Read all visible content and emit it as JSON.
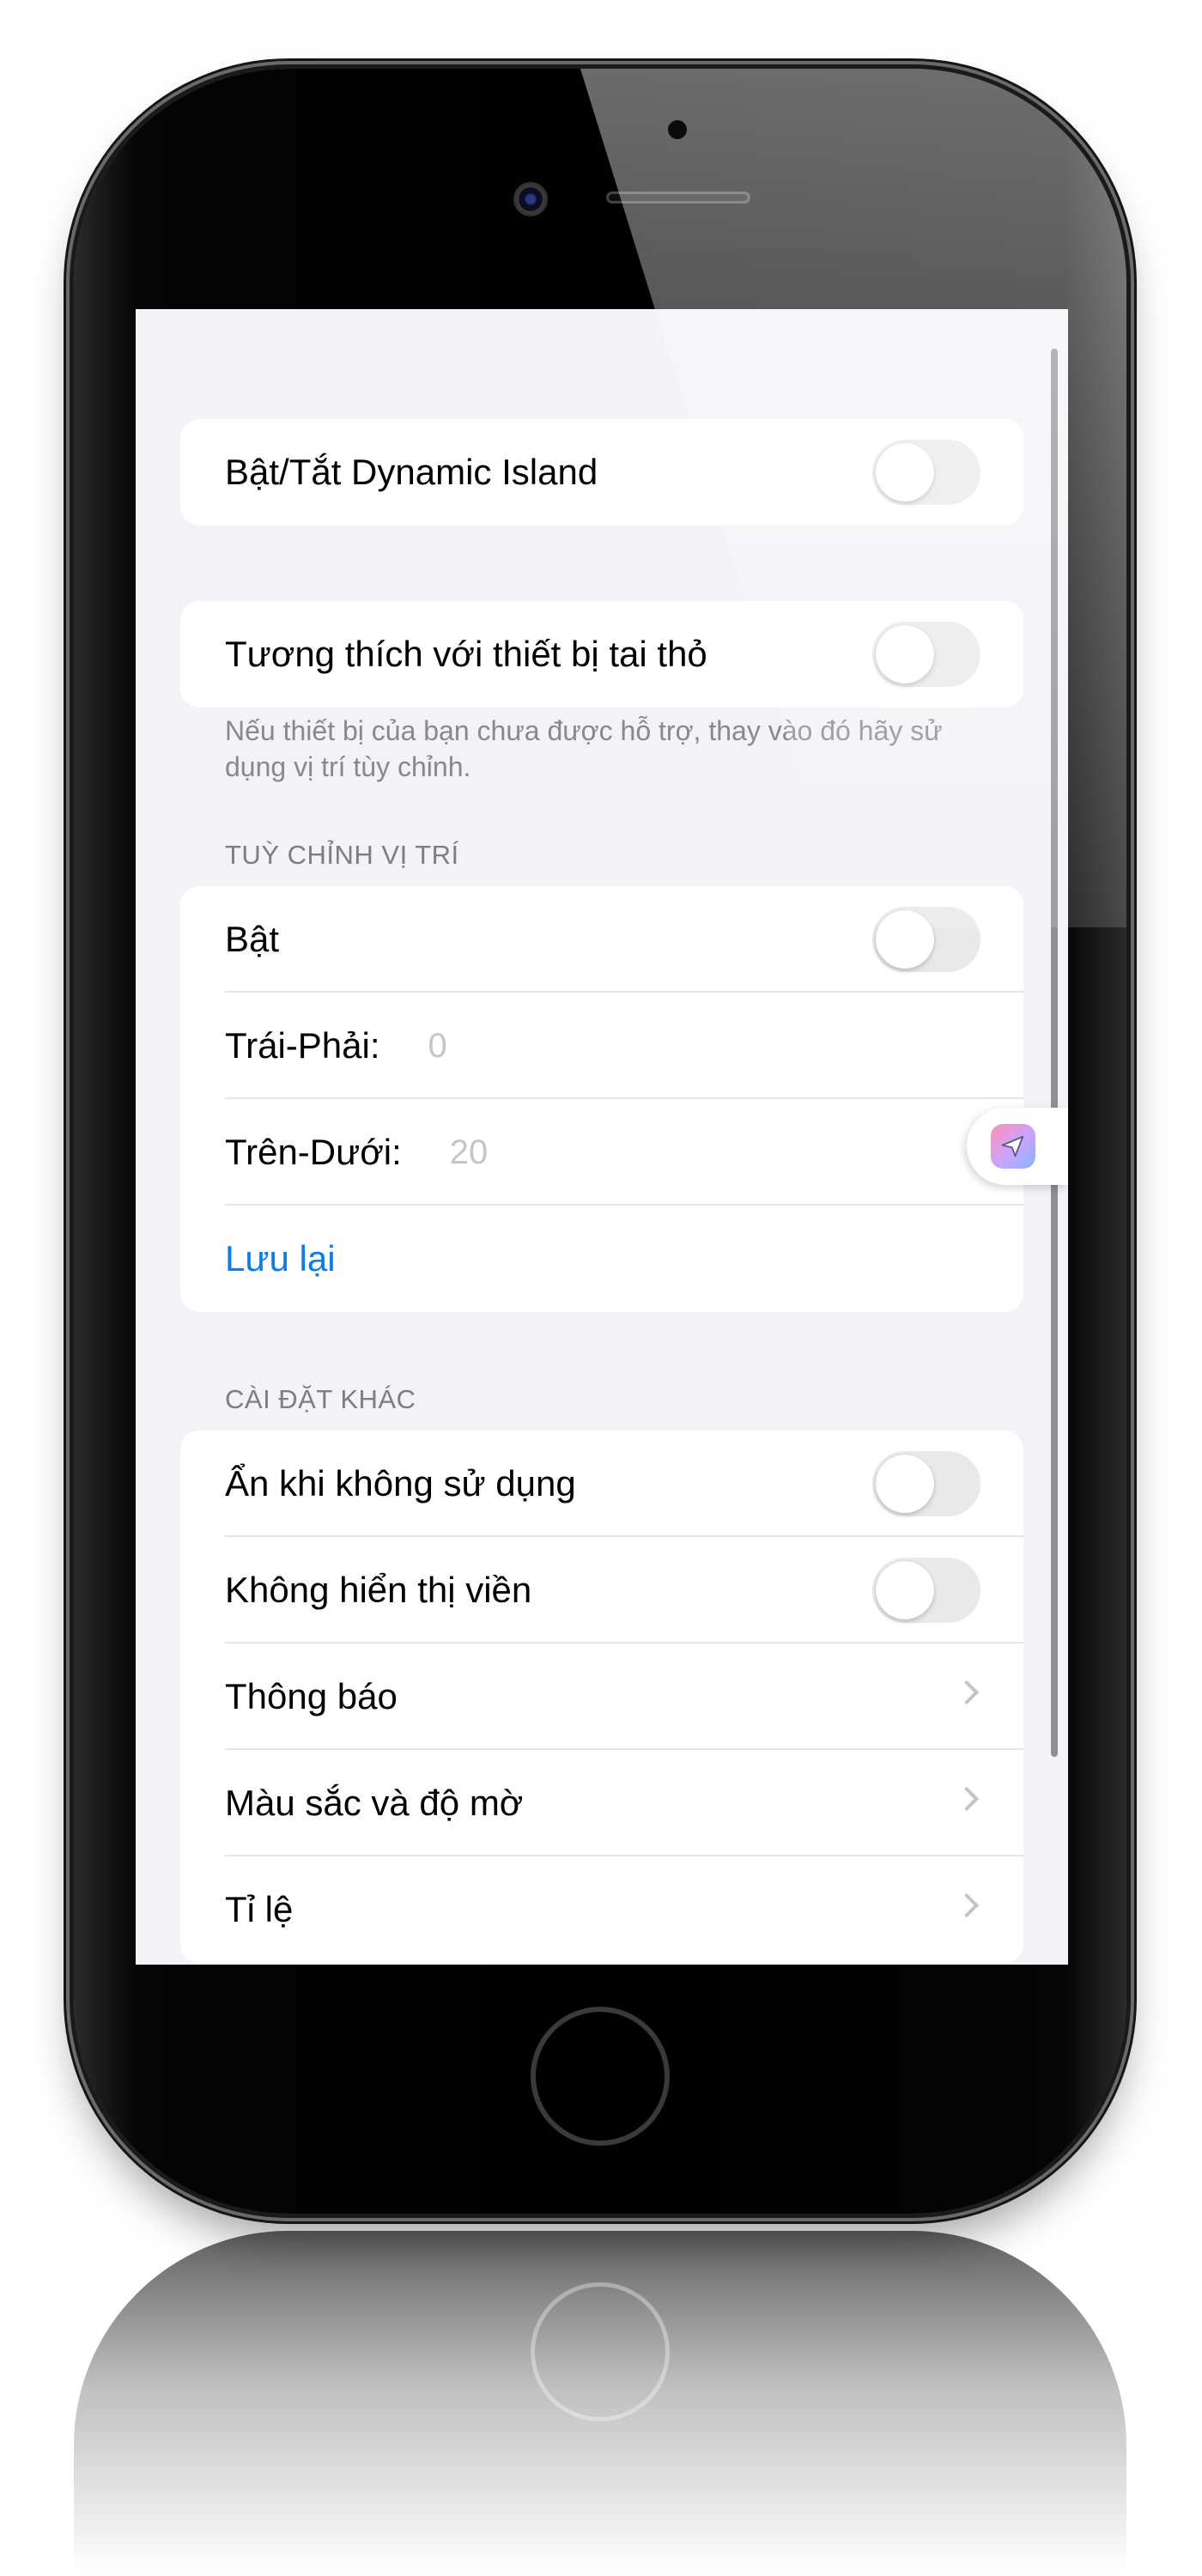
{
  "colors": {
    "background": "#f2f2f7",
    "card": "#ffffff",
    "accent": "#0a7cf2",
    "toggle_off": "#e9e9ea",
    "section_header": "#7d7d82"
  },
  "settings": {
    "dynamic_island": {
      "label": "Bật/Tắt Dynamic Island",
      "enabled": false
    },
    "notch_compat": {
      "label": "Tương thích với thiết bị tai thỏ",
      "enabled": false,
      "footer": "Nếu thiết bị của bạn chưa được hỗ trợ, thay vào đó hãy sử dụng vị trí tùy chỉnh."
    },
    "custom_position": {
      "header": "TUỲ CHỈNH VỊ TRÍ",
      "enable_label": "Bật",
      "enabled": false,
      "left_right_label": "Trái-Phải:",
      "left_right_placeholder": "0",
      "top_bottom_label": "Trên-Dưới:",
      "top_bottom_placeholder": "20",
      "save_label": "Lưu lại"
    },
    "other": {
      "header": "CÀI ĐẶT KHÁC",
      "hide_when_unused_label": "Ẩn khi không sử dụng",
      "hide_when_unused_enabled": false,
      "no_border_label": "Không hiển thị viền",
      "no_border_enabled": false,
      "notifications_label": "Thông báo",
      "color_opacity_label": "Màu sắc và độ mờ",
      "scale_label": "Tỉ lệ"
    }
  },
  "icons": {
    "chevron": "chevron-right-icon",
    "floating": "paper-plane-icon"
  }
}
